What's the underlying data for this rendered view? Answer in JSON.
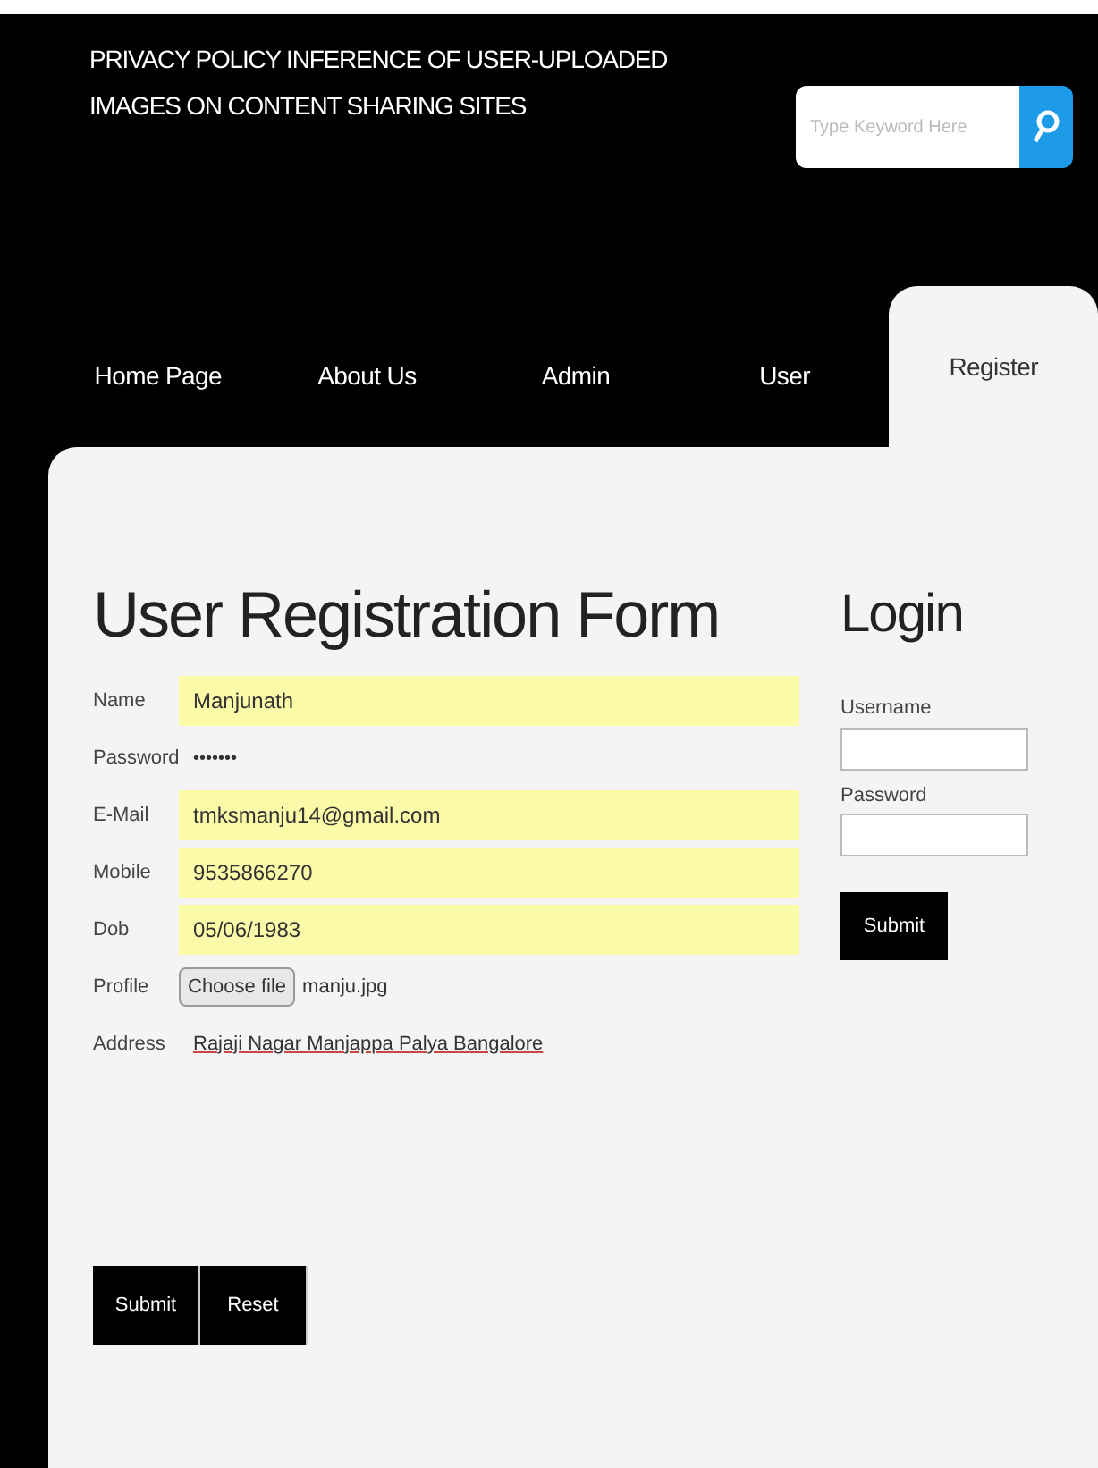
{
  "header": {
    "title_lines": [
      "PRIVACY POLICY INFERENCE OF USER-UPLOADED",
      "IMAGES ON CONTENT SHARING SITES"
    ]
  },
  "search": {
    "placeholder": "Type Keyword Here"
  },
  "nav": [
    {
      "label": "Home Page",
      "selected": false
    },
    {
      "label": "About Us",
      "selected": false
    },
    {
      "label": "Admin",
      "selected": false
    },
    {
      "label": "User",
      "selected": false
    },
    {
      "label": "Register",
      "selected": true
    }
  ],
  "registration": {
    "title": "User Registration Form",
    "fields": [
      {
        "label": "Name",
        "kind": "text",
        "value": "Manjunath"
      },
      {
        "label": "Password",
        "kind": "password",
        "value": "•••••••"
      },
      {
        "label": "E-Mail",
        "kind": "text",
        "value": "tmksmanju14@gmail.com"
      },
      {
        "label": "Mobile",
        "kind": "text",
        "value": "9535866270"
      },
      {
        "label": "Dob",
        "kind": "text",
        "value": "05/06/1983"
      },
      {
        "label": "Profile",
        "kind": "file",
        "button": "Choose file",
        "value": "manju.jpg"
      },
      {
        "label": "Address",
        "kind": "plain",
        "value": "Rajaji Nagar Manjappa Palya Bangalore"
      }
    ],
    "buttons": [
      "Submit",
      "Reset"
    ]
  },
  "login": {
    "title": "Login",
    "fields": [
      {
        "label": "Username"
      },
      {
        "label": "Password"
      }
    ],
    "button": "Submit"
  }
}
